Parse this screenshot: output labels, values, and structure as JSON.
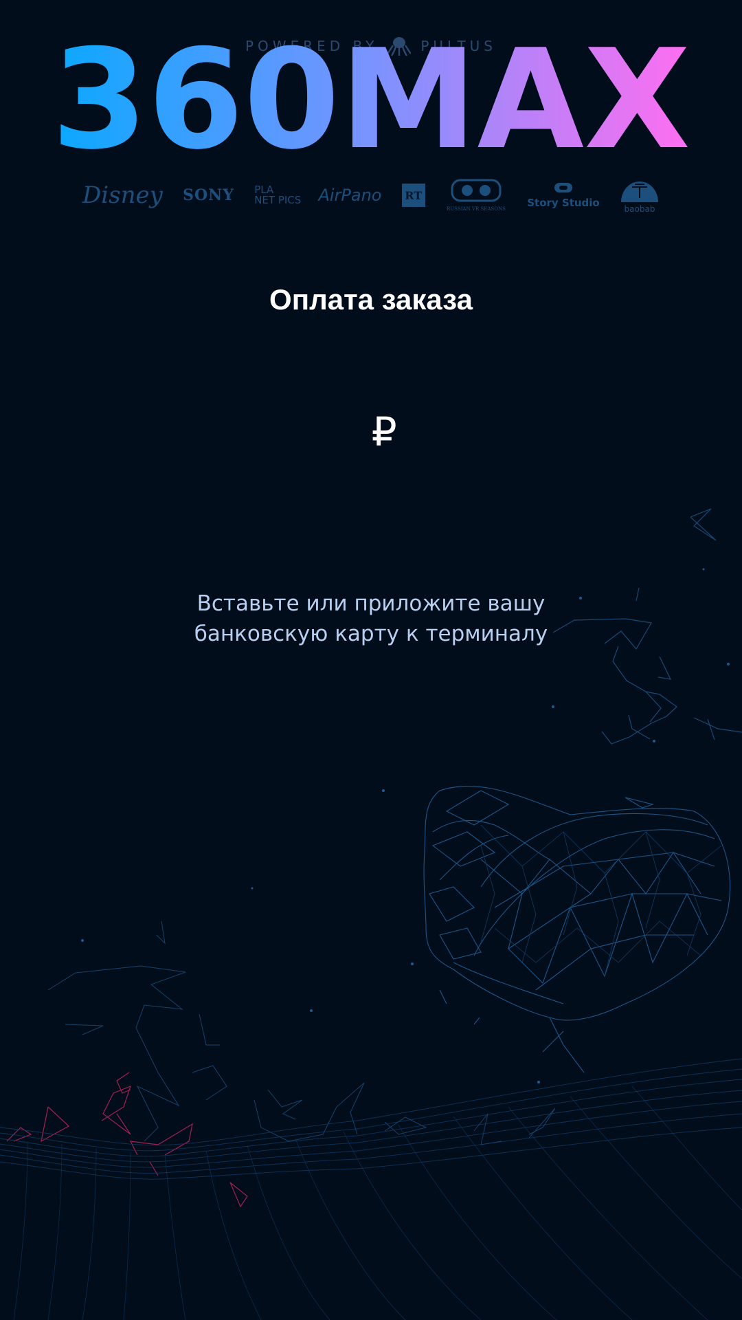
{
  "header": {
    "powered_by": "POWERED BY",
    "powered_brand": "PULTUS",
    "logo_text": "360MAX",
    "logo_gradient": [
      "#0aa8ff",
      "#7a93ff",
      "#ff6ef0"
    ]
  },
  "partners": {
    "disney": "Disney",
    "sony": "SONY",
    "planet_line1": "PLA",
    "planet_line2": "NET PICS",
    "airpano": "AirPano",
    "rt": "RT",
    "rvr": "RUSSIAN VR SEASONS",
    "story": "Story Studio",
    "baobab": "baobab"
  },
  "payment": {
    "title": "Оплата заказа",
    "amount": "",
    "currency": "₽",
    "instruction_line1": "Вставьте или приложите вашу",
    "instruction_line2": "банковскую карту к терминалу"
  },
  "colors": {
    "background": "#020d1b",
    "partner_logo": "#1d4f7c",
    "instruction_text": "#b8cff0",
    "wireframe": "#1e5a8c",
    "accent_pink": "#c0245c"
  },
  "icons": {
    "octopus": "octopus-icon",
    "vr_headset": "vr-headset-illustration"
  }
}
